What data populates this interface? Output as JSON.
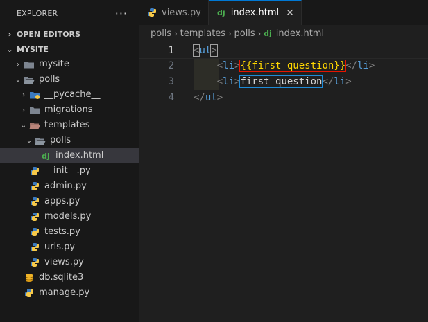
{
  "explorer": {
    "title": "EXPLORER",
    "more_label": "···",
    "open_editors": "OPEN EDITORS",
    "project": "MYSITE",
    "items": [
      {
        "label": "mysite"
      },
      {
        "label": "polls"
      },
      {
        "label": "__pycache__"
      },
      {
        "label": "migrations"
      },
      {
        "label": "templates"
      },
      {
        "label": "polls"
      },
      {
        "label": "index.html"
      },
      {
        "label": "__init__.py"
      },
      {
        "label": "admin.py"
      },
      {
        "label": "apps.py"
      },
      {
        "label": "models.py"
      },
      {
        "label": "tests.py"
      },
      {
        "label": "urls.py"
      },
      {
        "label": "views.py"
      },
      {
        "label": "db.sqlite3"
      },
      {
        "label": "manage.py"
      }
    ]
  },
  "tabs": [
    {
      "label": "views.py"
    },
    {
      "label": "index.html",
      "close": "✕"
    }
  ],
  "breadcrumb": [
    "polls",
    "templates",
    "polls",
    "index.html"
  ],
  "editor": {
    "line_numbers": [
      "1",
      "2",
      "3",
      "4"
    ],
    "lines": [
      {
        "open": "<",
        "tag": "ul",
        "close": ">"
      },
      {
        "indent": "    ",
        "open": "<",
        "tag": "li",
        "close": ">",
        "content": "{{first_question}}",
        "end_open": "</",
        "end_tag": "li",
        "end_close": ">"
      },
      {
        "indent": "    ",
        "open": "<",
        "tag": "li",
        "close": ">",
        "content": "first_question",
        "end_open": "</",
        "end_tag": "li",
        "end_close": ">"
      },
      {
        "open": "</",
        "tag": "ul",
        "close": ">"
      }
    ]
  },
  "colors": {
    "highlight_red": "#e51400",
    "highlight_blue": "#1e8ad6",
    "python_icon": "#3b7bbf",
    "django_icon": "#4caf50",
    "folder_icon": "#7d8590"
  }
}
